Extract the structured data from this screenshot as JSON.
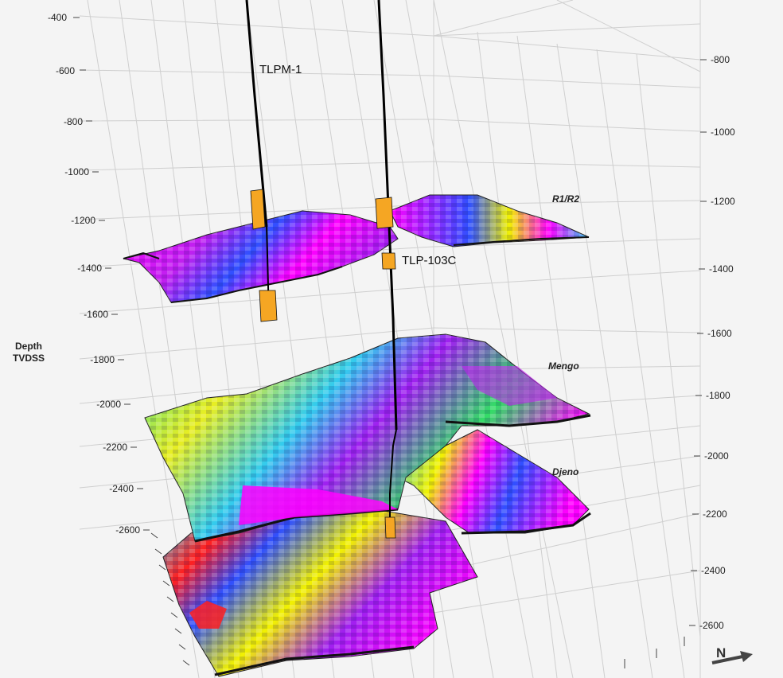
{
  "axis": {
    "title_line1": "Depth",
    "title_line2": "TVDSS",
    "left_ticks": [
      "-400",
      "-600",
      "-800",
      "-1000",
      "-1200",
      "-1400",
      "-1600",
      "-1800",
      "-2000",
      "-2200",
      "-2400",
      "-2600"
    ],
    "right_ticks": [
      "-800",
      "-1000",
      "-1200",
      "-1400",
      "-1600",
      "-1800",
      "-2000",
      "-2200",
      "-2400",
      "-2600"
    ]
  },
  "wells": [
    {
      "label": "TLPM-1"
    },
    {
      "label": "TLP-103C"
    }
  ],
  "surfaces": [
    {
      "label": "R1/R2",
      "dominant_color": "#ff00ff"
    },
    {
      "label": "Mengo",
      "dominant_color": "#33ddcc"
    },
    {
      "label": "Djeno",
      "dominant_color": "#33ccee"
    }
  ],
  "compass": {
    "label": "N"
  },
  "colors": {
    "magenta": "#ff00ff",
    "purple": "#a020f0",
    "blue": "#3050ff",
    "cyan": "#00e5ff",
    "green": "#33dd66",
    "yellow": "#f2f200",
    "orange": "#ff8c00",
    "red": "#ff2020",
    "log_fill": "#f5a623",
    "grid": "#c8c8c8"
  }
}
